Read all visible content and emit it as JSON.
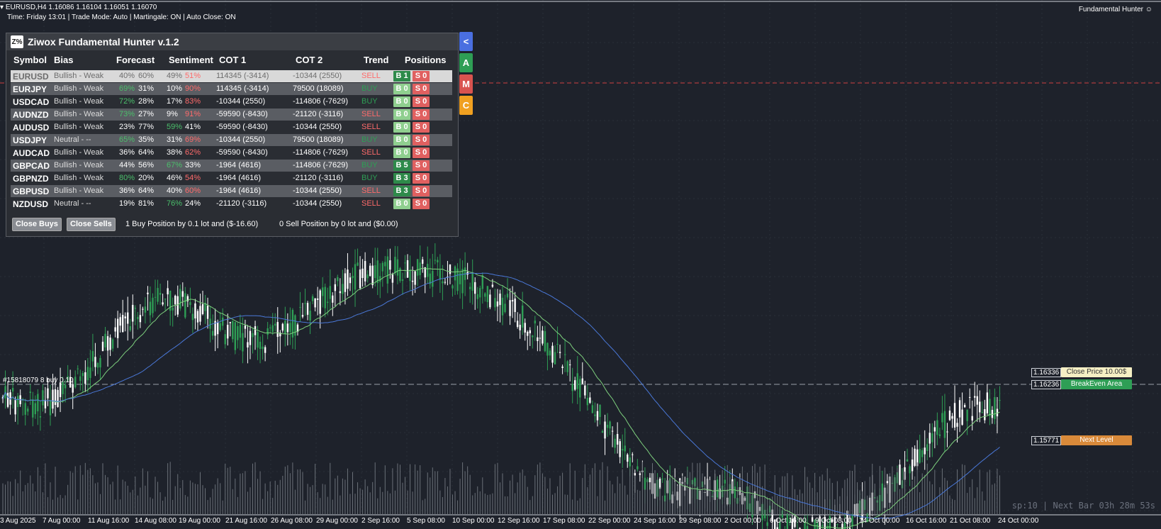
{
  "chart_header": {
    "symbol_line": "EURUSD,H4  1.16086 1.16104 1.16051 1.16070",
    "info_line": "Time: Friday 13:01 | Trade Mode: Auto | Martingale: ON | Auto Close: ON",
    "ea_name": "Fundamental Hunter"
  },
  "order_label": "#15818079 8 buy 0.10",
  "status_bar": "sp:10 | Next Bar 03h 28m 53s",
  "price_levels": {
    "close_price": {
      "price": "1.16336",
      "tag": "Close Price 10.00$"
    },
    "breakeven": {
      "price": "1.16236",
      "tag": "BreakEven Area"
    },
    "next_level": {
      "price": "1.15771",
      "tag": "Next Level"
    }
  },
  "x_axis": [
    "3 Aug 2025",
    "7 Aug 00:00",
    "11 Aug 16:00",
    "14 Aug 08:00",
    "19 Aug 00:00",
    "21 Aug 16:00",
    "26 Aug 08:00",
    "29 Aug 00:00",
    "2 Sep 16:00",
    "5 Sep 08:00",
    "10 Sep 00:00",
    "12 Sep 16:00",
    "17 Sep 08:00",
    "22 Sep 00:00",
    "24 Sep 16:00",
    "29 Sep 08:00",
    "2 Oct 00:00",
    "6 Oct 16:00",
    "9 Oct 08:00",
    "14 Oct 00:00",
    "16 Oct 16:00",
    "21 Oct 08:00",
    "24 Oct 00:00"
  ],
  "panel": {
    "title": "Ziwox Fundamental Hunter v.1.2",
    "logo": "Z%",
    "headers": {
      "symbol": "Symbol",
      "bias": "Bias",
      "forecast": "Forecast",
      "sentiment": "Sentiment",
      "cot1": "COT 1",
      "cot2": "COT 2",
      "trend": "Trend",
      "positions": "Positions"
    },
    "rows": [
      {
        "symbol": "EURUSD",
        "bias": "Bullish - Weak",
        "f1": "40%",
        "f2": "60%",
        "s1": "49%",
        "s2": "51%",
        "cot1": "114345 (-3414)",
        "cot2": "-10344 (2550)",
        "trend": "SELL",
        "b": "B 1",
        "s": "S 0"
      },
      {
        "symbol": "EURJPY",
        "bias": "Bullish - Weak",
        "f1": "69%",
        "f2": "31%",
        "s1": "10%",
        "s2": "90%",
        "cot1": "114345 (-3414)",
        "cot2": "79500 (18089)",
        "trend": "BUY",
        "b": "B 0",
        "s": "S 0"
      },
      {
        "symbol": "USDCAD",
        "bias": "Bullish - Weak",
        "f1": "72%",
        "f2": "28%",
        "s1": "17%",
        "s2": "83%",
        "cot1": "-10344 (2550)",
        "cot2": "-114806 (-7629)",
        "trend": "BUY",
        "b": "B 0",
        "s": "S 0"
      },
      {
        "symbol": "AUDNZD",
        "bias": "Bullish - Weak",
        "f1": "73%",
        "f2": "27%",
        "s1": "9%",
        "s2": "91%",
        "cot1": "-59590 (-8430)",
        "cot2": "-21120 (-3116)",
        "trend": "SELL",
        "b": "B 0",
        "s": "S 0"
      },
      {
        "symbol": "AUDUSD",
        "bias": "Bullish - Weak",
        "f1": "23%",
        "f2": "77%",
        "s1": "59%",
        "s2": "41%",
        "cot1": "-59590 (-8430)",
        "cot2": "-10344 (2550)",
        "trend": "SELL",
        "b": "B 0",
        "s": "S 0"
      },
      {
        "symbol": "USDJPY",
        "bias": "Neutral - --",
        "f1": "65%",
        "f2": "35%",
        "s1": "31%",
        "s2": "69%",
        "cot1": "-10344 (2550)",
        "cot2": "79500 (18089)",
        "trend": "BUY",
        "b": "B 0",
        "s": "S 0"
      },
      {
        "symbol": "AUDCAD",
        "bias": "Bullish - Weak",
        "f1": "36%",
        "f2": "64%",
        "s1": "38%",
        "s2": "62%",
        "cot1": "-59590 (-8430)",
        "cot2": "-114806 (-7629)",
        "trend": "SELL",
        "b": "B 0",
        "s": "S 0"
      },
      {
        "symbol": "GBPCAD",
        "bias": "Bullish - Weak",
        "f1": "44%",
        "f2": "56%",
        "s1": "67%",
        "s2": "33%",
        "cot1": "-1964 (4616)",
        "cot2": "-114806 (-7629)",
        "trend": "BUY",
        "b": "B 5",
        "s": "S 0"
      },
      {
        "symbol": "GBPNZD",
        "bias": "Bullish - Weak",
        "f1": "80%",
        "f2": "20%",
        "s1": "46%",
        "s2": "54%",
        "cot1": "-1964 (4616)",
        "cot2": "-21120 (-3116)",
        "trend": "BUY",
        "b": "B 3",
        "s": "S 0"
      },
      {
        "symbol": "GBPUSD",
        "bias": "Bullish - Weak",
        "f1": "36%",
        "f2": "64%",
        "s1": "40%",
        "s2": "60%",
        "cot1": "-1964 (4616)",
        "cot2": "-10344 (2550)",
        "trend": "SELL",
        "b": "B 3",
        "s": "S 0"
      },
      {
        "symbol": "NZDUSD",
        "bias": "Neutral - --",
        "f1": "19%",
        "f2": "81%",
        "s1": "76%",
        "s2": "24%",
        "cot1": "-21120 (-3116)",
        "cot2": "-10344 (2550)",
        "trend": "SELL",
        "b": "B 0",
        "s": "S 0"
      }
    ],
    "close_buys": "Close Buys",
    "close_sells": "Close Sells",
    "buy_summary": "1 Buy Position by 0.1 lot and ($-16.60)",
    "sell_summary": "0 Sell Position by 0 lot and ($0.00)"
  },
  "side_buttons": [
    "<",
    "A",
    "M",
    "C"
  ],
  "colors": {
    "bg": "#1e222b",
    "bull": "#2e9e55",
    "bear": "#ffffff",
    "green_text": "#4bbf6b",
    "red_text": "#ff6b6b",
    "blue": "#4a6fe0",
    "orange": "#f0a020"
  }
}
